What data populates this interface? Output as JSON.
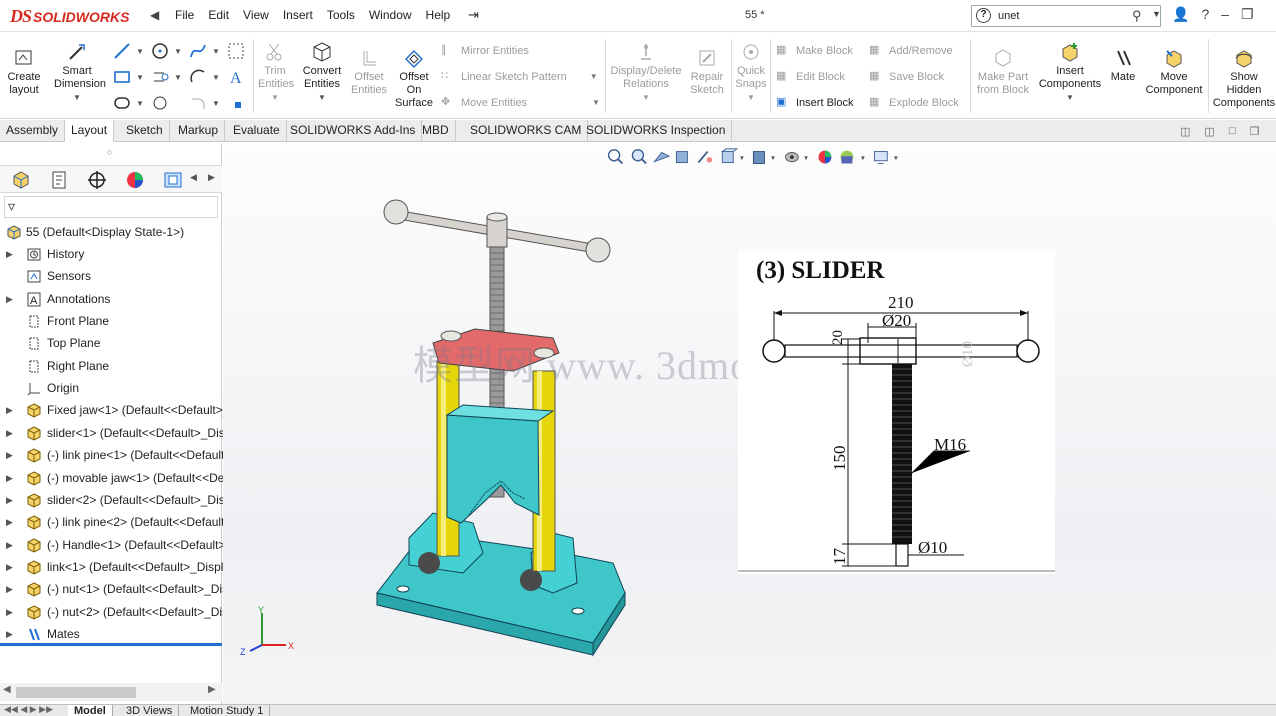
{
  "app": {
    "brand_ds": "DS",
    "brand_name": "SOLIDWORKS",
    "doc_title": "55 *"
  },
  "menu": [
    "File",
    "Edit",
    "View",
    "Insert",
    "Tools",
    "Window",
    "Help"
  ],
  "search": {
    "value": "unet"
  },
  "ribbon": {
    "create_layout": "Create layout",
    "smart_dimension": "Smart Dimension",
    "trim_entities": "Trim Entities",
    "convert_entities": "Convert Entities",
    "offset_entities": "Offset Entities",
    "offset_on_surface": "Offset On Surface",
    "mirror_entities": "Mirror Entities",
    "linear_sketch_pattern": "Linear Sketch Pattern",
    "move_entities": "Move Entities",
    "display_delete_relations": "Display/Delete Relations",
    "repair_sketch": "Repair Sketch",
    "quick_snaps": "Quick Snaps",
    "make_block": "Make Block",
    "edit_block": "Edit Block",
    "insert_block": "Insert Block",
    "add_remove": "Add/Remove",
    "save_block": "Save Block",
    "explode_block": "Explode Block",
    "make_part_from_block": "Make Part from Block",
    "insert_components": "Insert Components",
    "mate": "Mate",
    "move_component": "Move Component",
    "show_hidden_components": "Show Hidden Components"
  },
  "tabs": [
    "Assembly",
    "Layout",
    "Sketch",
    "Markup",
    "Evaluate",
    "SOLIDWORKS Add-Ins",
    "MBD",
    "SOLIDWORKS CAM",
    "SOLIDWORKS Inspection"
  ],
  "active_tab": "Layout",
  "tree": {
    "root": "55  (Default<Display State-1>)",
    "items": [
      {
        "label": "History",
        "icon": "history-icon",
        "expandable": true
      },
      {
        "label": "Sensors",
        "icon": "sensor-icon",
        "expandable": false
      },
      {
        "label": "Annotations",
        "icon": "annotation-icon",
        "expandable": true
      },
      {
        "label": "Front Plane",
        "icon": "plane-icon",
        "expandable": false
      },
      {
        "label": "Top Plane",
        "icon": "plane-icon",
        "expandable": false
      },
      {
        "label": "Right Plane",
        "icon": "plane-icon",
        "expandable": false
      },
      {
        "label": "Origin",
        "icon": "origin-icon",
        "expandable": false
      },
      {
        "label": "Fixed jaw<1> (Default<<Default>_D",
        "icon": "part-icon",
        "expandable": true
      },
      {
        "label": "slider<1> (Default<<Default>_Disp",
        "icon": "part-icon",
        "expandable": true
      },
      {
        "label": "(-) link pine<1> (Default<<Default",
        "icon": "part-icon",
        "expandable": true
      },
      {
        "label": "(-) movable jaw<1> (Default<<De",
        "icon": "part-icon",
        "expandable": true
      },
      {
        "label": "slider<2> (Default<<Default>_Disp",
        "icon": "part-icon",
        "expandable": true
      },
      {
        "label": "(-) link pine<2> (Default<<Default",
        "icon": "part-icon",
        "expandable": true
      },
      {
        "label": "(-) Handle<1> (Default<<Default>_",
        "icon": "part-icon",
        "expandable": true
      },
      {
        "label": "link<1> (Default<<Default>_Displa",
        "icon": "part-icon",
        "expandable": true
      },
      {
        "label": "(-) nut<1> (Default<<Default>_Dis",
        "icon": "part-icon",
        "expandable": true
      },
      {
        "label": "(-) nut<2> (Default<<Default>_Dis",
        "icon": "part-icon",
        "expandable": true
      },
      {
        "label": "Mates",
        "icon": "mates-icon",
        "expandable": true
      }
    ]
  },
  "bottom_tabs": [
    "Model",
    "3D Views",
    "Motion Study 1"
  ],
  "drawing": {
    "title": "(3) SLIDER",
    "dim_overall": "210",
    "dim_dia_top": "Ø20",
    "dim_20": "20",
    "dim_150": "150",
    "dim_17": "17",
    "thread": "M16",
    "dim_dia_bottom": "Ø10",
    "dim_faded": "Ø10"
  },
  "watermark": "模型网 www. 3dmo",
  "triad": {
    "x": "X",
    "y": "Y",
    "z": "Z"
  },
  "colors": {
    "brand": "#d52b1e",
    "base": "#3ec6c9",
    "rods": "#e5d60b",
    "link": "#e36a6a",
    "active_blue": "#1f6fd1"
  }
}
